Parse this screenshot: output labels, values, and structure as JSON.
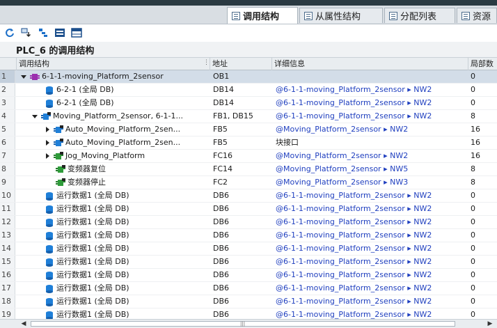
{
  "tabs": [
    {
      "label": "调用结构",
      "active": true
    },
    {
      "label": "从属性结构",
      "active": false
    },
    {
      "label": "分配列表",
      "active": false
    },
    {
      "label": "资源",
      "active": false
    }
  ],
  "toolbar": {
    "icons": [
      "refresh-icon",
      "show-instances-icon",
      "expand-icon",
      "collapse-all-icon",
      "table-view-icon"
    ]
  },
  "panel_title": "PLC_6 的调用结构",
  "columns": {
    "call_structure": "调用结构",
    "address": "地址",
    "details": "详细信息",
    "local": "局部数"
  },
  "rows": [
    {
      "num": "1",
      "name": "6-1-1-moving_Platform_2sensor",
      "address": "OB1",
      "details": "",
      "local": "0",
      "level": 0,
      "expand": "down",
      "icon": "ob"
    },
    {
      "num": "2",
      "name": "6-2-1 (全局 DB)",
      "address": "DB14",
      "details": "@6-1-1-moving_Platform_2sensor ▸ NW2",
      "local": "0",
      "level": 1,
      "expand": "none",
      "icon": "db"
    },
    {
      "num": "3",
      "name": "6-2-1 (全局 DB)",
      "address": "DB14",
      "details": "@6-1-1-moving_Platform_2sensor ▸ NW2",
      "local": "0",
      "level": 1,
      "expand": "none",
      "icon": "db"
    },
    {
      "num": "4",
      "name": "Moving_Platform_2sensor, 6-1-1...",
      "address": "FB1, DB15",
      "details": "@6-1-1-moving_Platform_2sensor ▸ NW2",
      "local": "8",
      "level": 1,
      "expand": "down",
      "icon": "fb"
    },
    {
      "num": "5",
      "name": "Auto_Moving_Platform_2sen...",
      "address": "FB5",
      "details": "@Moving_Platform_2sensor ▸ NW2",
      "local": "16",
      "level": 2,
      "expand": "right",
      "icon": "fb"
    },
    {
      "num": "6",
      "name": "Auto_Moving_Platform_2sen...",
      "address": "FB5",
      "details": "块接口",
      "local": "16",
      "level": 2,
      "expand": "right",
      "icon": "fb"
    },
    {
      "num": "7",
      "name": "Jog_Moving_Platform",
      "address": "FC16",
      "details": "@Moving_Platform_2sensor ▸ NW2",
      "local": "16",
      "level": 2,
      "expand": "right",
      "icon": "fc"
    },
    {
      "num": "8",
      "name": "变频器复位",
      "address": "FC14",
      "details": "@Moving_Platform_2sensor ▸ NW5",
      "local": "8",
      "level": 2,
      "expand": "none",
      "icon": "fc"
    },
    {
      "num": "9",
      "name": "变频器停止",
      "address": "FC2",
      "details": "@Moving_Platform_2sensor ▸ NW3",
      "local": "8",
      "level": 2,
      "expand": "none",
      "icon": "fc"
    },
    {
      "num": "10",
      "name": "运行数据1 (全局 DB)",
      "address": "DB6",
      "details": "@6-1-1-moving_Platform_2sensor ▸ NW2",
      "local": "0",
      "level": 1,
      "expand": "none",
      "icon": "db"
    },
    {
      "num": "11",
      "name": "运行数据1 (全局 DB)",
      "address": "DB6",
      "details": "@6-1-1-moving_Platform_2sensor ▸ NW2",
      "local": "0",
      "level": 1,
      "expand": "none",
      "icon": "db"
    },
    {
      "num": "12",
      "name": "运行数据1 (全局 DB)",
      "address": "DB6",
      "details": "@6-1-1-moving_Platform_2sensor ▸ NW2",
      "local": "0",
      "level": 1,
      "expand": "none",
      "icon": "db"
    },
    {
      "num": "13",
      "name": "运行数据1 (全局 DB)",
      "address": "DB6",
      "details": "@6-1-1-moving_Platform_2sensor ▸ NW2",
      "local": "0",
      "level": 1,
      "expand": "none",
      "icon": "db"
    },
    {
      "num": "14",
      "name": "运行数据1 (全局 DB)",
      "address": "DB6",
      "details": "@6-1-1-moving_Platform_2sensor ▸ NW2",
      "local": "0",
      "level": 1,
      "expand": "none",
      "icon": "db"
    },
    {
      "num": "15",
      "name": "运行数据1 (全局 DB)",
      "address": "DB6",
      "details": "@6-1-1-moving_Platform_2sensor ▸ NW2",
      "local": "0",
      "level": 1,
      "expand": "none",
      "icon": "db"
    },
    {
      "num": "16",
      "name": "运行数据1 (全局 DB)",
      "address": "DB6",
      "details": "@6-1-1-moving_Platform_2sensor ▸ NW2",
      "local": "0",
      "level": 1,
      "expand": "none",
      "icon": "db"
    },
    {
      "num": "17",
      "name": "运行数据1 (全局 DB)",
      "address": "DB6",
      "details": "@6-1-1-moving_Platform_2sensor ▸ NW2",
      "local": "0",
      "level": 1,
      "expand": "none",
      "icon": "db"
    },
    {
      "num": "18",
      "name": "运行数据1 (全局 DB)",
      "address": "DB6",
      "details": "@6-1-1-moving_Platform_2sensor ▸ NW2",
      "local": "0",
      "level": 1,
      "expand": "none",
      "icon": "db"
    },
    {
      "num": "19",
      "name": "运行数据1 (全局 DB)",
      "address": "DB6",
      "details": "@6-1-1-moving_Platform_2sensor ▸ NW2",
      "local": "0",
      "level": 1,
      "expand": "none",
      "icon": "db"
    }
  ],
  "colors": {
    "link": "#1f3fbf",
    "selected_row": "#d3dde8",
    "ob_icon": "#9b2fae",
    "block_icon": "#1f7fd8",
    "fc_icon": "#2e9b3a"
  }
}
